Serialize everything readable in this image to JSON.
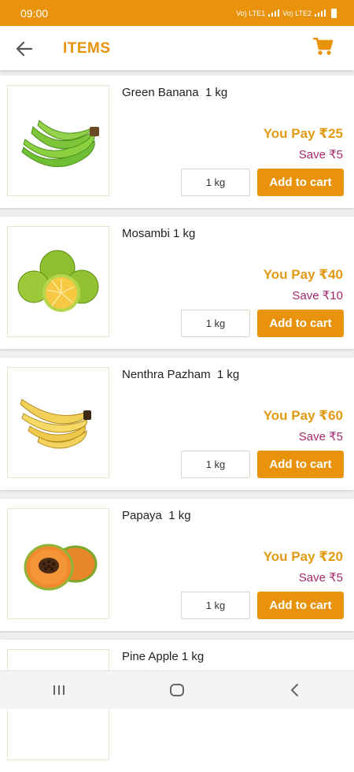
{
  "status_bar": {
    "time": "09:00",
    "network_1": "Vo) LTE1",
    "network_2": "Vo) LTE2"
  },
  "app_bar": {
    "title": "ITEMS"
  },
  "items": [
    {
      "name": "Green Banana  1 kg",
      "pay": "You Pay ₹25",
      "save": "Save ₹5",
      "qty": "1 kg",
      "add": "Add to cart"
    },
    {
      "name": "Mosambi 1 kg",
      "pay": "You Pay ₹40",
      "save": "Save ₹10",
      "qty": "1 kg",
      "add": "Add to cart"
    },
    {
      "name": "Nenthra Pazham  1 kg",
      "pay": "You Pay ₹60",
      "save": "Save ₹5",
      "qty": "1 kg",
      "add": "Add to cart"
    },
    {
      "name": "Papaya  1 kg",
      "pay": "You Pay ₹20",
      "save": "Save ₹5",
      "qty": "1 kg",
      "add": "Add to cart"
    },
    {
      "name": "Pine Apple 1 kg"
    }
  ],
  "colors": {
    "accent": "#e8930b",
    "save_text": "#a52a6d",
    "pay_text": "#e29a12"
  },
  "icons": {
    "back": "arrow-left-icon",
    "cart": "shopping-cart-icon",
    "recents": "recents-icon",
    "home": "home-icon",
    "nav_back": "chevron-left-icon"
  }
}
